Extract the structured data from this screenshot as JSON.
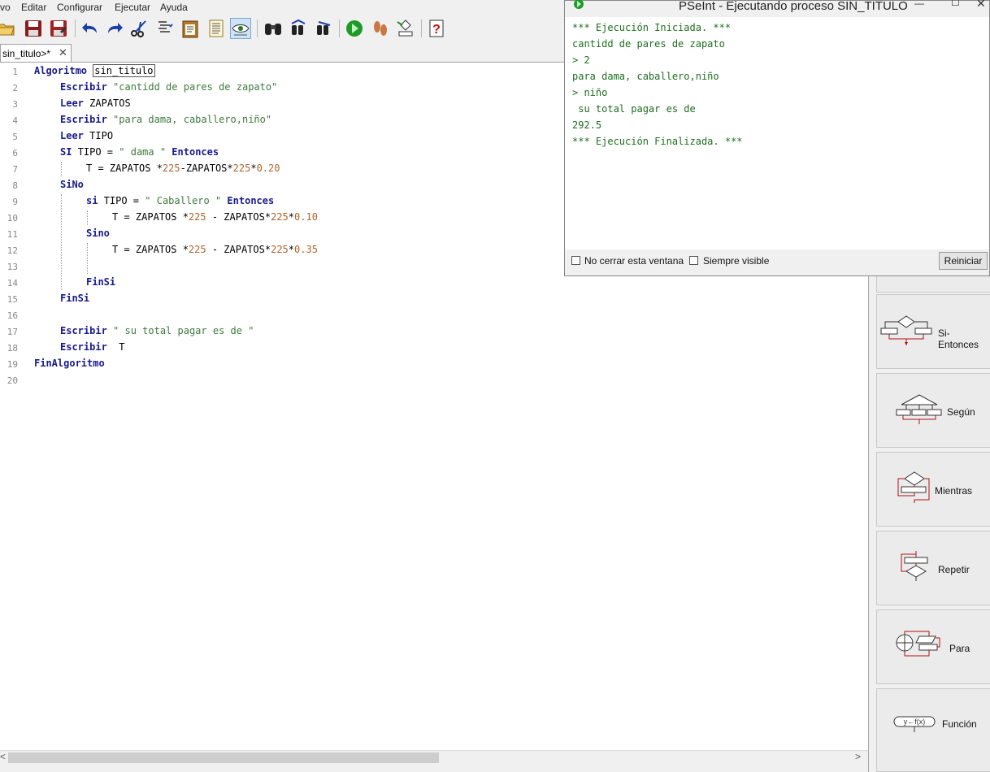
{
  "menu": {
    "items": [
      "vo",
      "Editar",
      "Configurar",
      "Ejecutar",
      "Ayuda"
    ]
  },
  "toolbar": {
    "buttons": [
      "open-icon",
      "save-icon",
      "save-as-icon",
      "undo-icon",
      "redo-icon",
      "cut-icon",
      "copy-icon",
      "paste-icon",
      "select-all-icon",
      "indent-icon",
      "find-icon",
      "find-previous-icon",
      "find-next-icon",
      "run-icon",
      "step-by-step-icon",
      "flowchart-icon",
      "help-icon"
    ]
  },
  "editor": {
    "tab_label": "sin_titulo>*",
    "tab_close": "✕",
    "line_numbers": [
      "1",
      "2",
      "3",
      "4",
      "5",
      "6",
      "7",
      "8",
      "9",
      "10",
      "11",
      "12",
      "13",
      "14",
      "15",
      "16",
      "17",
      "18",
      "19",
      "20"
    ],
    "lines": {
      "l1_kw": "Algoritmo",
      "l1_name": "sin_titulo",
      "l2_kw": "Escribir",
      "l2_str": "\"cantidd de pares de zapato\"",
      "l3_kw": "Leer",
      "l3_var": "ZAPATOS",
      "l4_kw": "Escribir",
      "l4_str": "\"para dama, caballero,niño\"",
      "l5_kw": "Leer",
      "l5_var": "TIPO",
      "l6_kw": "SI",
      "l6_mid": "TIPO = ",
      "l6_str": "\" dama \"",
      "l6_kw2": "Entonces",
      "l7_a": "T = ZAPATOS *",
      "l7_n1": "225",
      "l7_b": "-ZAPATOS*",
      "l7_n2": "225",
      "l7_c": "*",
      "l7_n3": "0.20",
      "l8_kw": "SiNo",
      "l9_kw": "si",
      "l9_mid": "TIPO = ",
      "l9_str": "\" Caballero \"",
      "l9_kw2": "Entonces",
      "l10_a": "T = ZAPATOS *",
      "l10_n1": "225",
      "l10_b": " - ZAPATOS*",
      "l10_n2": "225",
      "l10_c": "*",
      "l10_n3": "0.10",
      "l11_kw": "Sino",
      "l12_a": "T = ZAPATOS *",
      "l12_n1": "225",
      "l12_b": " - ZAPATOS*",
      "l12_n2": "225",
      "l12_c": "*",
      "l12_n3": "0.35",
      "l14_kw": "FinSi",
      "l15_kw": "FinSi",
      "l17_kw": "Escribir",
      "l17_str": "\" su total pagar es de \"",
      "l18_kw": "Escribir",
      "l18_var": "T",
      "l19_kw": "FinAlgoritmo"
    }
  },
  "scrollbar": {
    "left_arrow": "<",
    "right_arrow": ">"
  },
  "output_window": {
    "title": "PSeInt - Ejecutando proceso SIN_TITULO",
    "minimize": "—",
    "maximize": "☐",
    "close": "✕",
    "console_lines": [
      "*** Ejecución Iniciada. ***",
      "cantidd de pares de zapato",
      "> 2",
      "para dama, caballero,niño",
      "> niño",
      " su total pagar es de ",
      "292.5",
      "*** Ejecución Finalizada. ***"
    ],
    "no_close_label": "No cerrar esta ventana",
    "always_visible_label": "Siempre visible",
    "restart_label": "Reiniciar"
  },
  "command_panel": {
    "items": [
      "Si-Entonces",
      "Según",
      "Mientras",
      "Repetir",
      "Para",
      "Función"
    ]
  },
  "colors": {
    "keyword": "#1a1a8c",
    "string": "#3d7a3d",
    "number": "#b0622b",
    "console_text": "#1e6e1e"
  }
}
